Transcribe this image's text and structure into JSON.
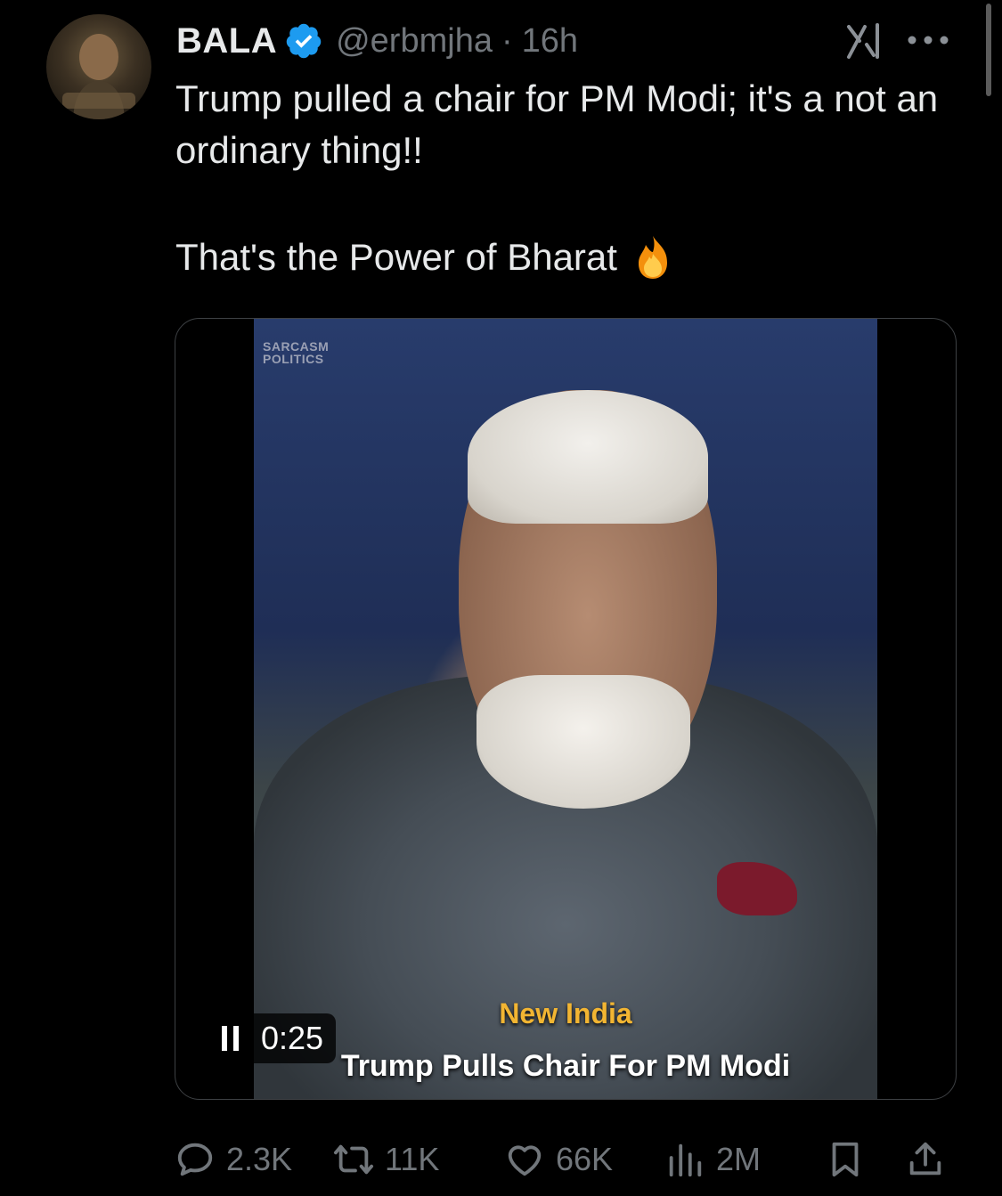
{
  "tweet": {
    "author": {
      "name": "BALA",
      "handle": "@erbmjha",
      "time": "16h",
      "verified_color": "#1d9bf0"
    },
    "text_lines": [
      "Trump pulled a chair for PM Modi; it's a not an ordinary thing!!",
      "That's the Power of Bharat"
    ],
    "emoji": "fire-emoji",
    "media": {
      "watermark": [
        "SARCASM",
        "POLITICS"
      ],
      "caption_top": "New India",
      "caption_bottom": "Trump Pulls Chair For PM Modi",
      "timestamp": "0:25",
      "state": "playing"
    },
    "actions": {
      "replies": "2.3K",
      "reposts": "11K",
      "likes": "66K",
      "views": "2M"
    }
  },
  "icons": [
    "grok-icon",
    "more-icon",
    "pause-icon",
    "reply-icon",
    "repost-icon",
    "like-icon",
    "views-icon",
    "bookmark-icon",
    "share-icon"
  ],
  "colors": {
    "background": "#000000",
    "text": "#e7e9ea",
    "secondary": "#71767b",
    "caption_accent": "#f2b532"
  }
}
